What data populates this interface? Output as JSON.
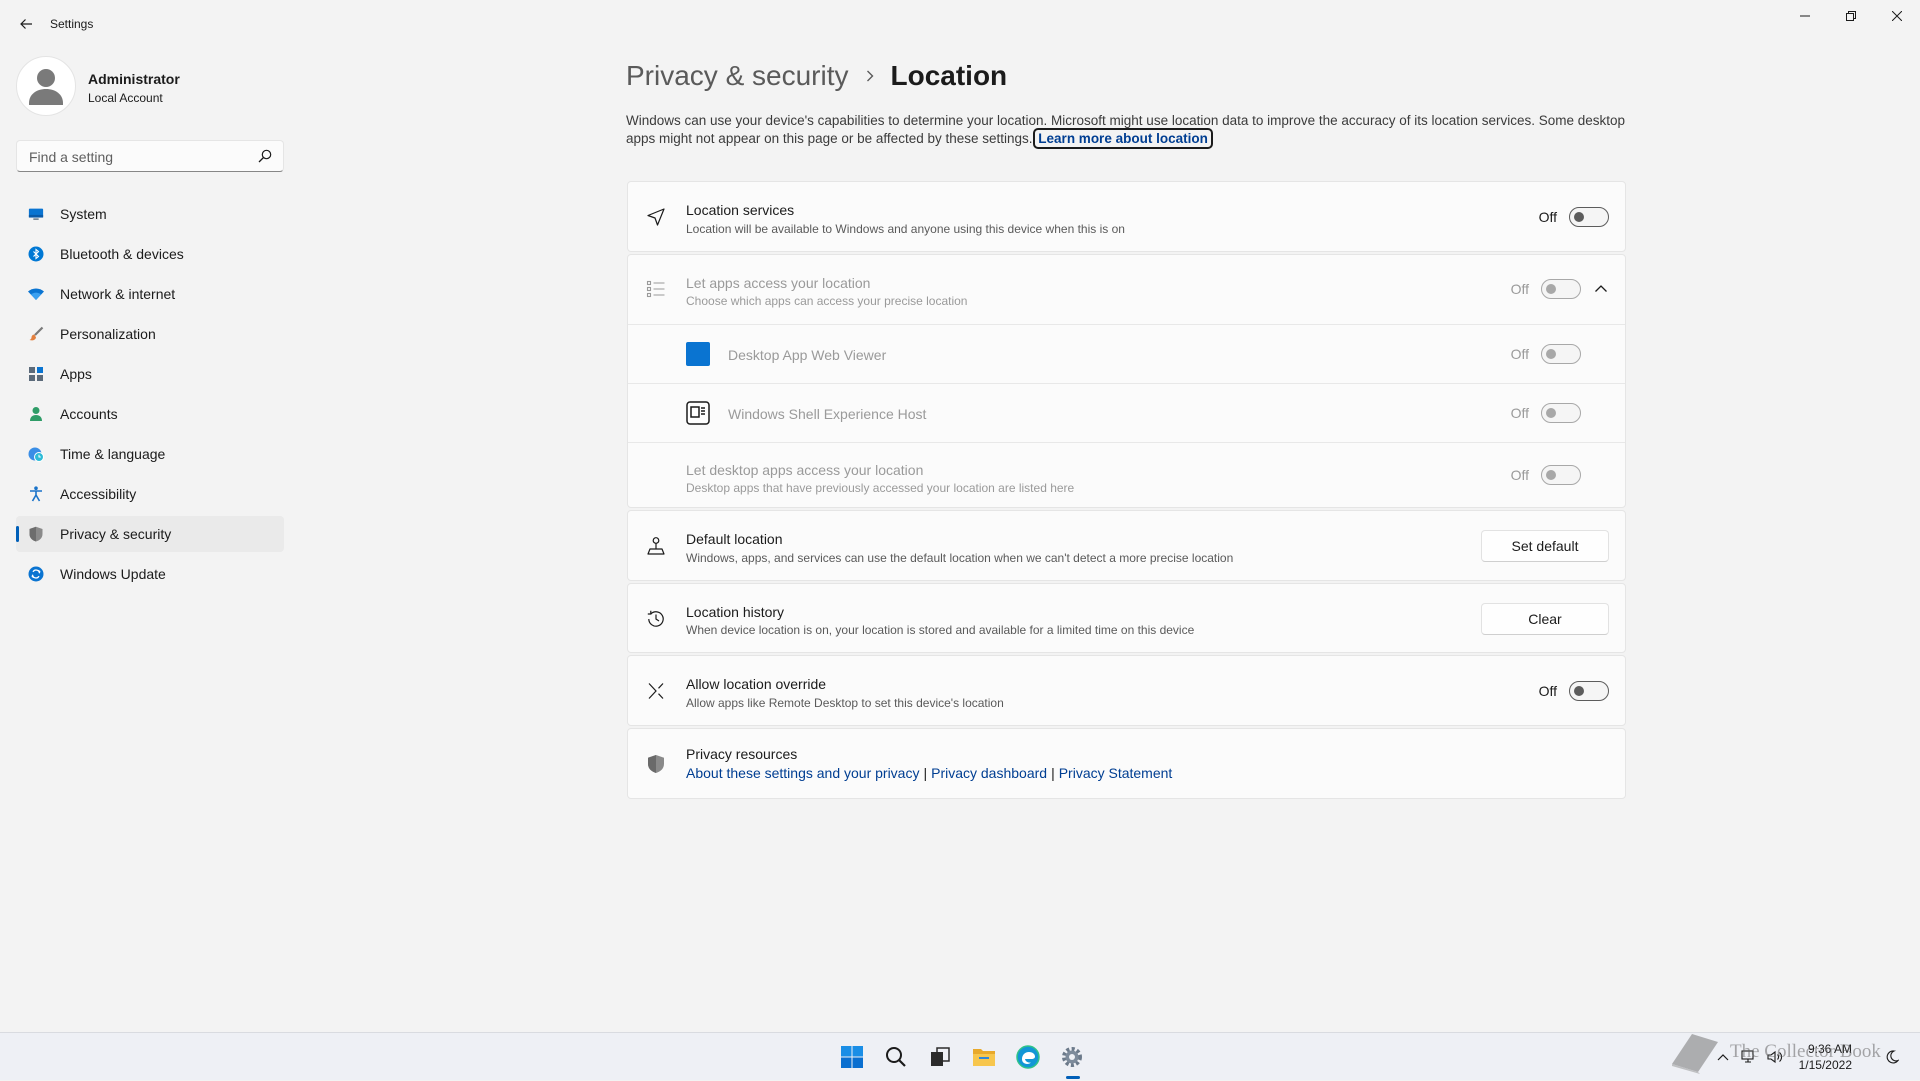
{
  "window": {
    "title": "Settings"
  },
  "user": {
    "name": "Administrator",
    "account_type": "Local Account"
  },
  "search": {
    "placeholder": "Find a setting"
  },
  "sidebar": {
    "items": [
      {
        "label": "System",
        "icon": "monitor-icon",
        "color": "#0067c0"
      },
      {
        "label": "Bluetooth & devices",
        "icon": "bluetooth-icon",
        "color": "#0078d4"
      },
      {
        "label": "Network & internet",
        "icon": "wifi-icon",
        "color": "#0067c0"
      },
      {
        "label": "Personalization",
        "icon": "brush-icon",
        "color": "#e3803f"
      },
      {
        "label": "Apps",
        "icon": "apps-icon",
        "color": "#5b6a7a"
      },
      {
        "label": "Accounts",
        "icon": "person-icon",
        "color": "#2e9c67"
      },
      {
        "label": "Time & language",
        "icon": "globe-clock-icon",
        "color": "#0078d4"
      },
      {
        "label": "Accessibility",
        "icon": "accessibility-icon",
        "color": "#1a73c9"
      },
      {
        "label": "Privacy & security",
        "icon": "shield-icon",
        "color": "#707070",
        "active": true
      },
      {
        "label": "Windows Update",
        "icon": "update-icon",
        "color": "#0078d4"
      }
    ]
  },
  "breadcrumb": {
    "parent": "Privacy & security",
    "current": "Location"
  },
  "description": {
    "text": "Windows can use your device's capabilities to determine your location. Microsoft might use location data to improve the accuracy of its location services. Some desktop apps might not appear on this page or be affected by these settings.",
    "link": "Learn more about location"
  },
  "location_services": {
    "title": "Location services",
    "subtitle": "Location will be available to Windows and anyone using this device when this is on",
    "state": "Off"
  },
  "app_access": {
    "title": "Let apps access your location",
    "subtitle": "Choose which apps can access your precise location",
    "state": "Off",
    "apps": [
      {
        "name": "Desktop App Web Viewer",
        "state": "Off"
      },
      {
        "name": "Windows Shell Experience Host",
        "state": "Off"
      }
    ],
    "desktop": {
      "title": "Let desktop apps access your location",
      "subtitle": "Desktop apps that have previously accessed your location are listed here",
      "state": "Off"
    }
  },
  "default_location": {
    "title": "Default location",
    "subtitle": "Windows, apps, and services can use the default location when we can't detect a more precise location",
    "button": "Set default"
  },
  "location_history": {
    "title": "Location history",
    "subtitle": "When device location is on, your location is stored and available for a limited time on this device",
    "button": "Clear"
  },
  "location_override": {
    "title": "Allow location override",
    "subtitle": "Allow apps like Remote Desktop to set this device's location",
    "state": "Off"
  },
  "privacy_resources": {
    "title": "Privacy resources",
    "links": [
      "About these settings and your privacy",
      "Privacy dashboard",
      "Privacy Statement"
    ]
  },
  "taskbar": {
    "time": "9:36 AM",
    "date": "1/15/2022"
  },
  "watermark": {
    "text": "The Collector Book"
  }
}
